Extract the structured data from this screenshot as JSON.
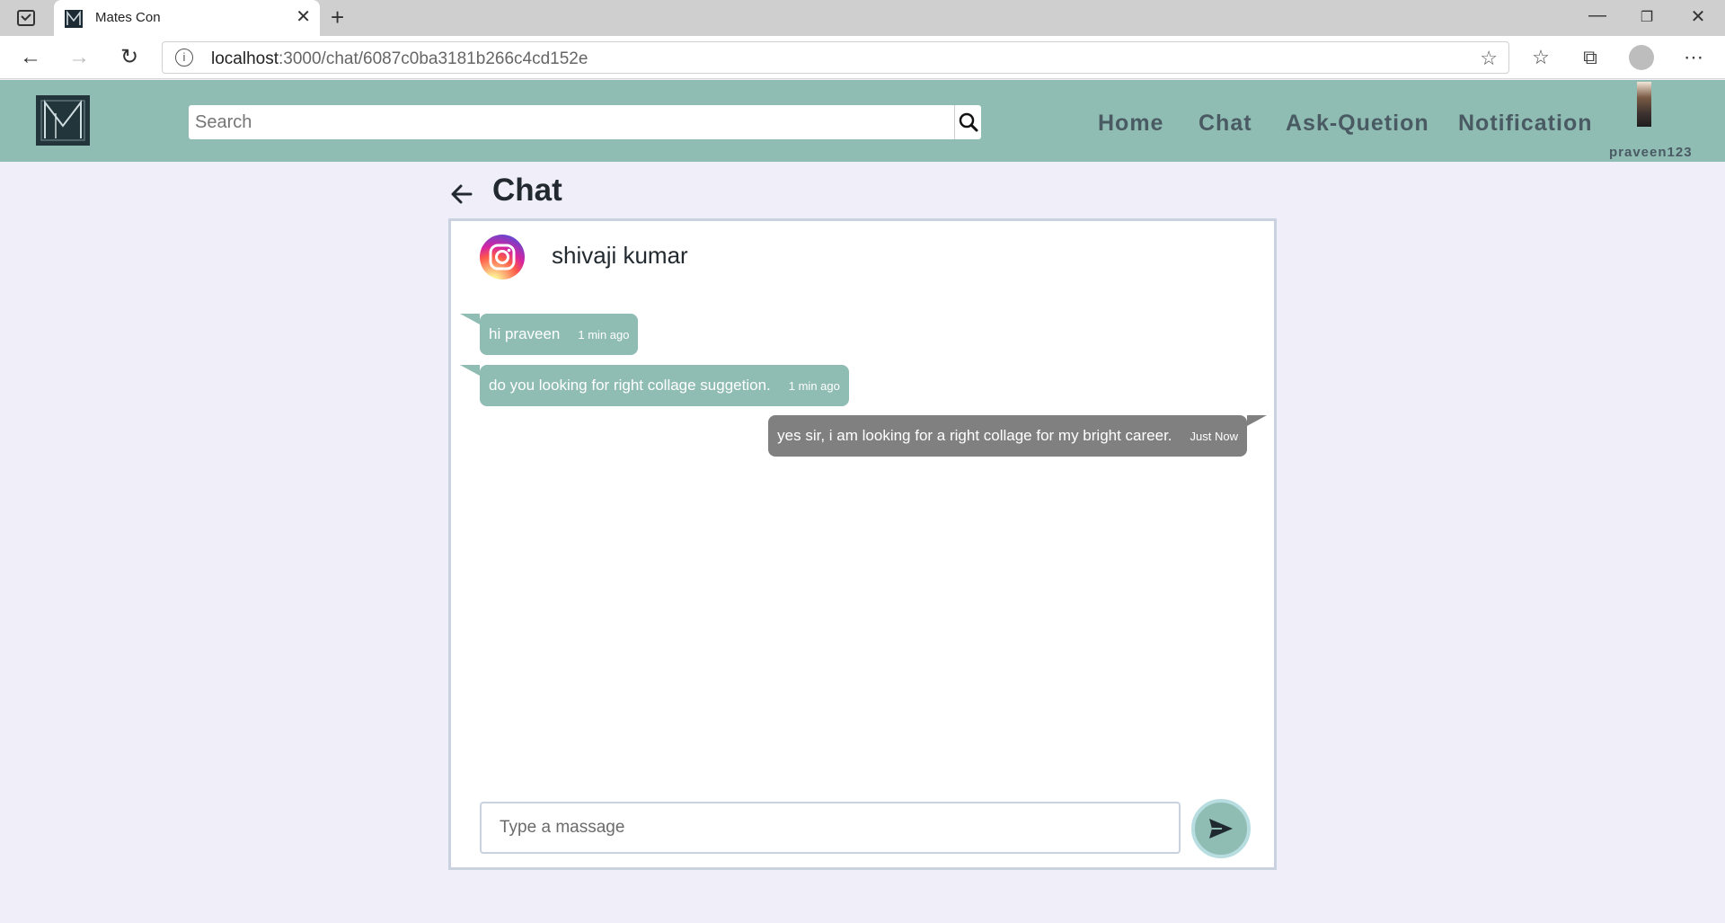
{
  "browser": {
    "tab_title": "Mates Con",
    "url_host": "localhost",
    "url_path": ":3000/chat/6087c0ba3181b266c4cd152e"
  },
  "header": {
    "search_placeholder": "Search",
    "nav": [
      "Home",
      "Chat",
      "Ask-Quetion",
      "Notification"
    ],
    "username": "praveen123",
    "accent_color": "#8fbcb3"
  },
  "chat": {
    "title": "Chat",
    "contact_name": "shivaji kumar",
    "messages": [
      {
        "side": "in",
        "text": "hi praveen",
        "time": "1 min ago"
      },
      {
        "side": "in",
        "text": "do you looking for right collage suggetion.",
        "time": "1 min ago"
      },
      {
        "side": "out",
        "text": "yes sir, i am looking for a right collage for my bright career.",
        "time": "Just Now"
      }
    ],
    "input_placeholder": "Type a massage"
  }
}
